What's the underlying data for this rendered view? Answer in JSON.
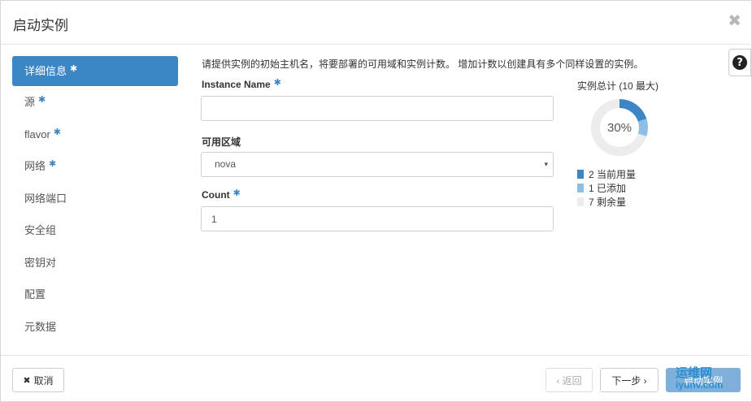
{
  "modal": {
    "title": "启动实例",
    "close_glyph": "✖"
  },
  "help": {
    "glyph": "?"
  },
  "nav": {
    "items": [
      {
        "label": "详细信息",
        "required": true,
        "active": true
      },
      {
        "label": "源",
        "required": true,
        "active": false
      },
      {
        "label": "flavor",
        "required": true,
        "active": false
      },
      {
        "label": "网络",
        "required": true,
        "active": false
      },
      {
        "label": "网络端口",
        "required": false,
        "active": false
      },
      {
        "label": "安全组",
        "required": false,
        "active": false
      },
      {
        "label": "密钥对",
        "required": false,
        "active": false
      },
      {
        "label": "配置",
        "required": false,
        "active": false
      },
      {
        "label": "元数据",
        "required": false,
        "active": false
      }
    ],
    "required_marker": "✱"
  },
  "form": {
    "description": "请提供实例的初始主机名，将要部署的可用域和实例计数。 增加计数以创建具有多个同样设置的实例。",
    "instance_name": {
      "label": "Instance Name",
      "value": "",
      "required": true
    },
    "availability_zone": {
      "label": "可用区域",
      "selected": "nova",
      "caret": "▾"
    },
    "count": {
      "label": "Count",
      "value": "1",
      "required": true
    }
  },
  "quota": {
    "title": "实例总计 (10 最大)",
    "percent_label": "30%",
    "total": 10,
    "legend": [
      {
        "count": "2",
        "label": "当前用量",
        "value": 2,
        "color": "#3d86c6"
      },
      {
        "count": "1",
        "label": "已添加",
        "value": 1,
        "color": "#8ebde6"
      },
      {
        "count": "7",
        "label": "剩余量",
        "value": 7,
        "color": "#ececec"
      }
    ]
  },
  "footer": {
    "cancel_label": "取消",
    "cancel_glyph": "✖",
    "back_label": "‹ 返回",
    "next_label": "下一步 ›",
    "launch_label": "启动实例"
  },
  "watermark": {
    "line1": "运维网",
    "line2": "iyunv.com"
  }
}
